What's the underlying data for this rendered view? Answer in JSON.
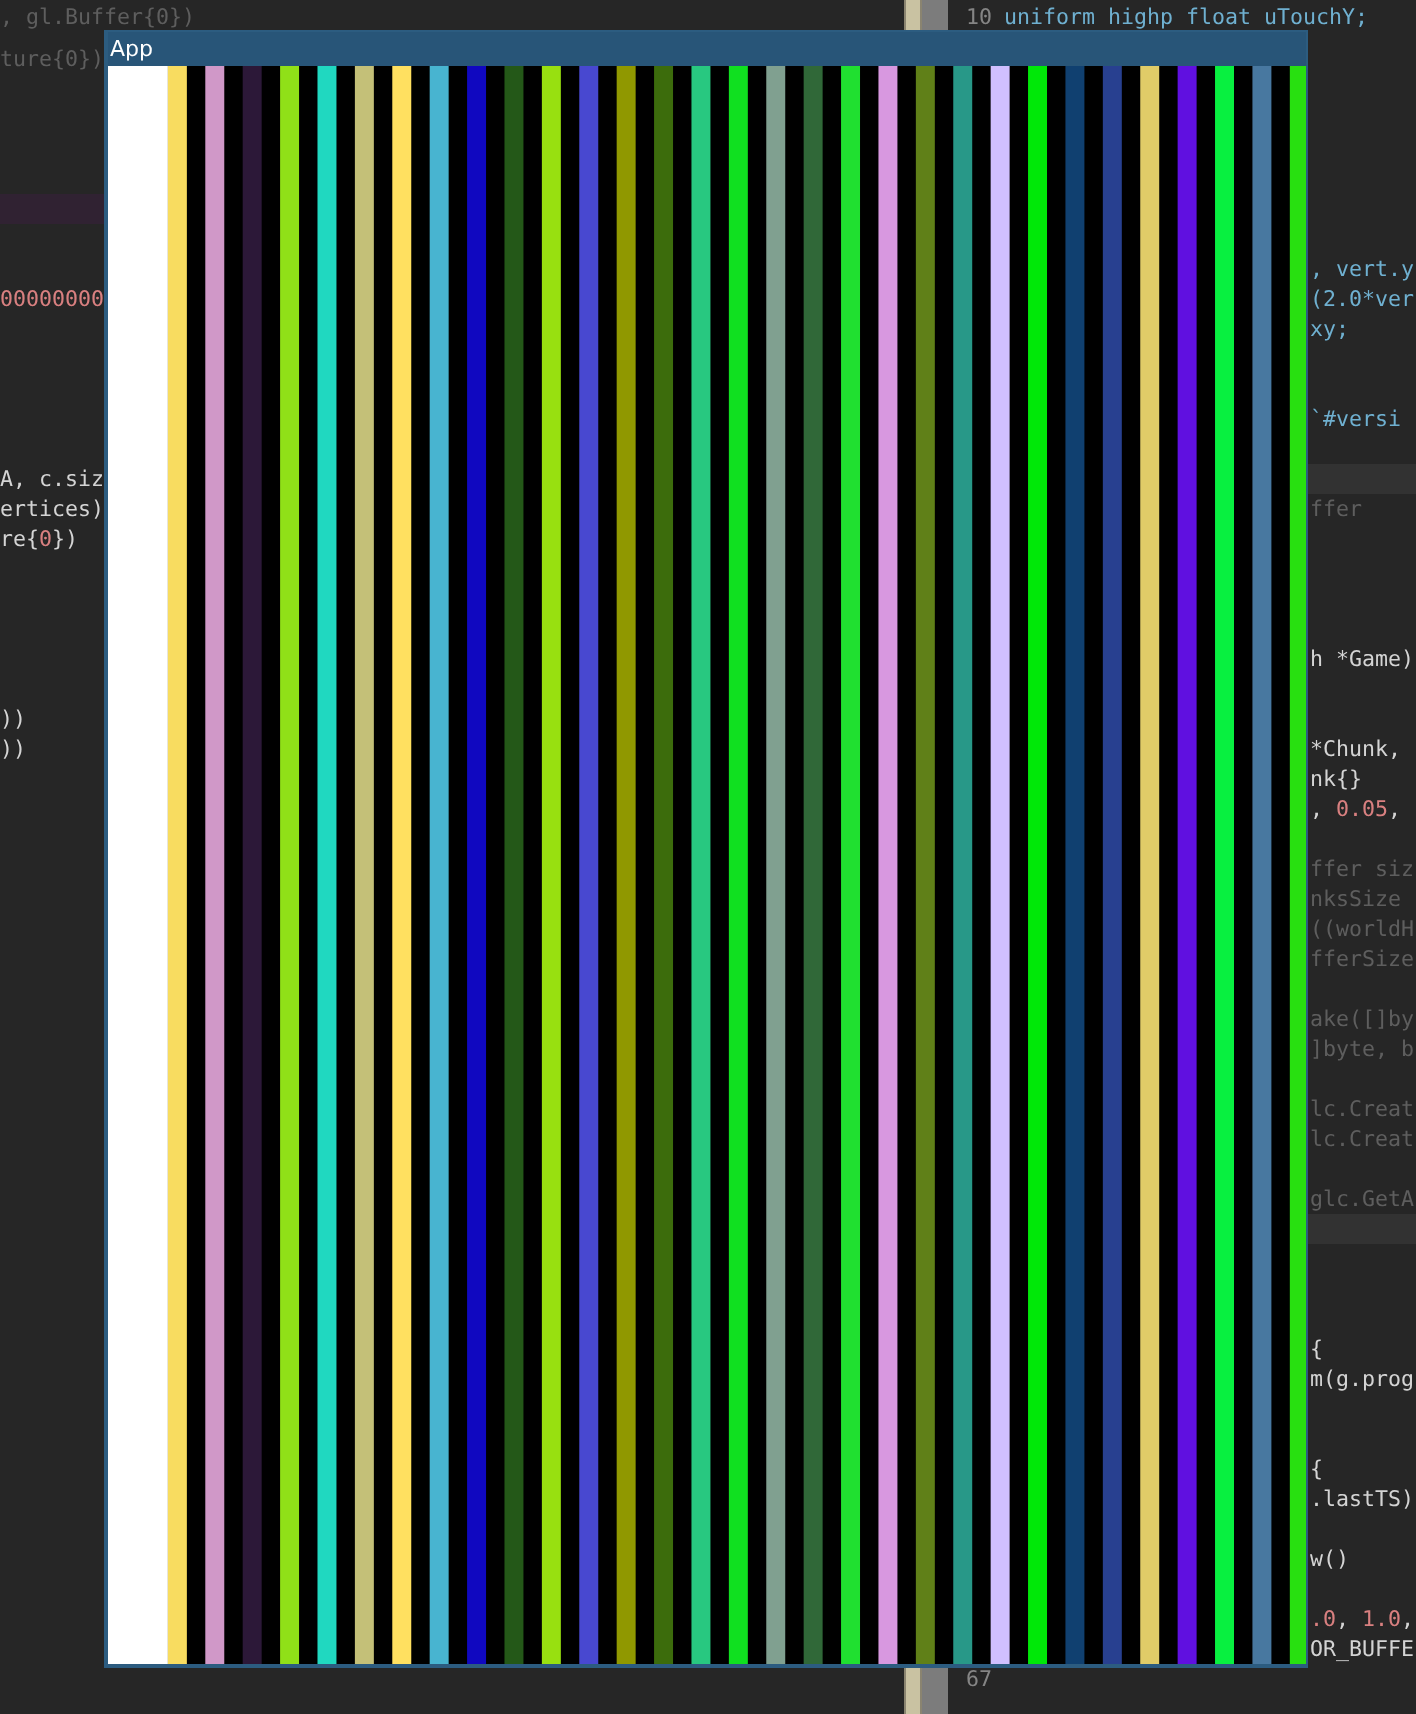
{
  "window": {
    "title": "App"
  },
  "editor": {
    "left_pane": {
      "lines": [
        {
          "highlighted": false,
          "tokens": [
            {
              "kind": "dim",
              "text": ", gl.Buffer{0})"
            }
          ]
        },
        {
          "highlighted": false,
          "tokens": [
            {
              "kind": "dim",
              "text": "ture{0})"
            }
          ]
        },
        {
          "highlighted": true
        },
        {
          "highlighted": false,
          "tokens": [
            {
              "kind": "number",
              "text": "00000000"
            }
          ]
        },
        {
          "highlighted": false,
          "tokens": [
            {
              "kind": "plain",
              "text": "A, c.siz"
            }
          ]
        },
        {
          "highlighted": false,
          "tokens": [
            {
              "kind": "plain",
              "text": "ertices)"
            }
          ]
        },
        {
          "highlighted": false,
          "tokens": [
            {
              "kind": "plain",
              "text": "re{"
            },
            {
              "kind": "number",
              "text": "0"
            },
            {
              "kind": "plain",
              "text": "})"
            }
          ]
        },
        {
          "highlighted": false,
          "tokens": [
            {
              "kind": "plain",
              "text": "))"
            }
          ]
        },
        {
          "highlighted": false,
          "tokens": [
            {
              "kind": "plain",
              "text": "))"
            }
          ]
        }
      ]
    },
    "right_pane": {
      "lines": [
        {
          "highlighted": false,
          "number": "10",
          "tokens": [
            {
              "kind": "string",
              "text": "uniform highp float uTouchY;"
            }
          ]
        },
        {
          "highlighted": false,
          "tokens": [
            {
              "kind": "string",
              "text": ", vert.y"
            }
          ]
        },
        {
          "highlighted": false,
          "tokens": [
            {
              "kind": "string",
              "text": "(2.0*ver"
            }
          ]
        },
        {
          "highlighted": false,
          "tokens": [
            {
              "kind": "string",
              "text": "xy;"
            }
          ]
        },
        {
          "highlighted": false,
          "tokens": [
            {
              "kind": "string",
              "text": "`#versi"
            }
          ]
        },
        {
          "highlighted": true
        },
        {
          "highlighted": false,
          "tokens": [
            {
              "kind": "dim",
              "text": "ffer"
            }
          ]
        },
        {
          "highlighted": false,
          "tokens": [
            {
              "kind": "plain",
              "text": "h *Game)"
            }
          ]
        },
        {
          "highlighted": false,
          "tokens": [
            {
              "kind": "plain",
              "text": "*Chunk,"
            }
          ]
        },
        {
          "highlighted": false,
          "tokens": [
            {
              "kind": "plain",
              "text": "nk{}"
            }
          ]
        },
        {
          "highlighted": false,
          "tokens": [
            {
              "kind": "plain",
              "text": ", "
            },
            {
              "kind": "number",
              "text": "0.05"
            },
            {
              "kind": "plain",
              "text": ","
            }
          ]
        },
        {
          "highlighted": false,
          "tokens": [
            {
              "kind": "dim",
              "text": "ffer siz"
            }
          ]
        },
        {
          "highlighted": false,
          "tokens": [
            {
              "kind": "dim",
              "text": "nksSize"
            }
          ]
        },
        {
          "highlighted": false,
          "tokens": [
            {
              "kind": "dim",
              "text": "((worldH"
            }
          ]
        },
        {
          "highlighted": false,
          "tokens": [
            {
              "kind": "dim",
              "text": "fferSize"
            }
          ]
        },
        {
          "highlighted": false,
          "tokens": [
            {
              "kind": "dim",
              "text": "ake([]by"
            }
          ]
        },
        {
          "highlighted": false,
          "tokens": [
            {
              "kind": "dim",
              "text": "]byte, b"
            }
          ]
        },
        {
          "highlighted": false,
          "tokens": [
            {
              "kind": "dim",
              "text": "lc.Creat"
            }
          ]
        },
        {
          "highlighted": false,
          "tokens": [
            {
              "kind": "dim",
              "text": "lc.Creat"
            }
          ]
        },
        {
          "highlighted": false,
          "tokens": [
            {
              "kind": "dim",
              "text": "glc.GetA"
            }
          ]
        },
        {
          "highlighted": true
        },
        {
          "highlighted": false,
          "tokens": [
            {
              "kind": "plain",
              "text": "{"
            }
          ]
        },
        {
          "highlighted": false,
          "tokens": [
            {
              "kind": "plain",
              "text": "m(g.prog"
            }
          ]
        },
        {
          "highlighted": false,
          "tokens": [
            {
              "kind": "plain",
              "text": "{"
            }
          ]
        },
        {
          "highlighted": false,
          "tokens": [
            {
              "kind": "plain",
              "text": ".lastTS)"
            }
          ]
        },
        {
          "highlighted": false,
          "tokens": [
            {
              "kind": "plain",
              "text": "w()"
            }
          ]
        },
        {
          "highlighted": false,
          "tokens": [
            {
              "kind": "number",
              "text": ".0"
            },
            {
              "kind": "plain",
              "text": ", "
            },
            {
              "kind": "number",
              "text": "1.0"
            },
            {
              "kind": "plain",
              "text": ","
            }
          ]
        },
        {
          "highlighted": false,
          "tokens": [
            {
              "kind": "plain",
              "text": "OR_BUFFE"
            }
          ]
        },
        {
          "highlighted": false,
          "number": "67"
        }
      ]
    }
  }
}
